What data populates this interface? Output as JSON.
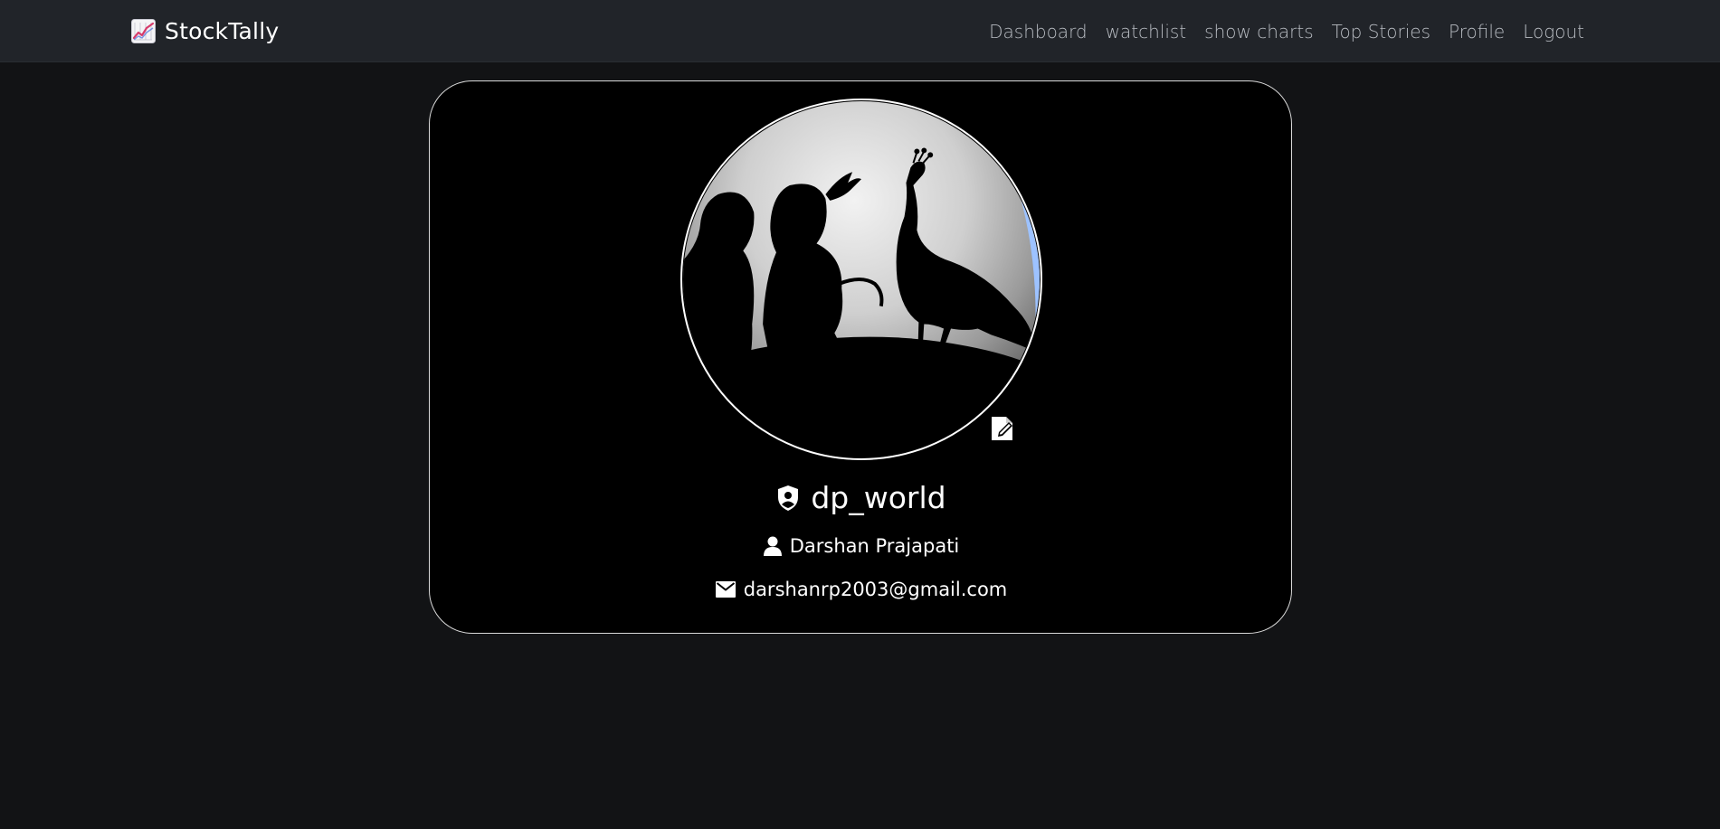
{
  "navbar": {
    "brand": {
      "name": "StockTally",
      "icon": "chart-increasing-icon"
    },
    "links": [
      {
        "label": "Dashboard"
      },
      {
        "label": "watchlist"
      },
      {
        "label": "show charts"
      },
      {
        "label": "Top Stories"
      },
      {
        "label": "Profile"
      },
      {
        "label": "Logout"
      }
    ]
  },
  "profile": {
    "username": "dp_world",
    "username_icon": "shield-user-icon",
    "full_name": "Darshan Prajapati",
    "full_name_icon": "person-icon",
    "email": "darshanrp2003@gmail.com",
    "email_icon": "envelope-icon",
    "avatar_icon": "avatar-silhouette-peacock",
    "edit_icon": "edit-document-icon"
  },
  "colors": {
    "page_bg": "#121315",
    "navbar_bg": "#212429",
    "nav_link": "#b8bcc2",
    "card_bg": "#000000",
    "card_border": "#d9d9d9"
  }
}
